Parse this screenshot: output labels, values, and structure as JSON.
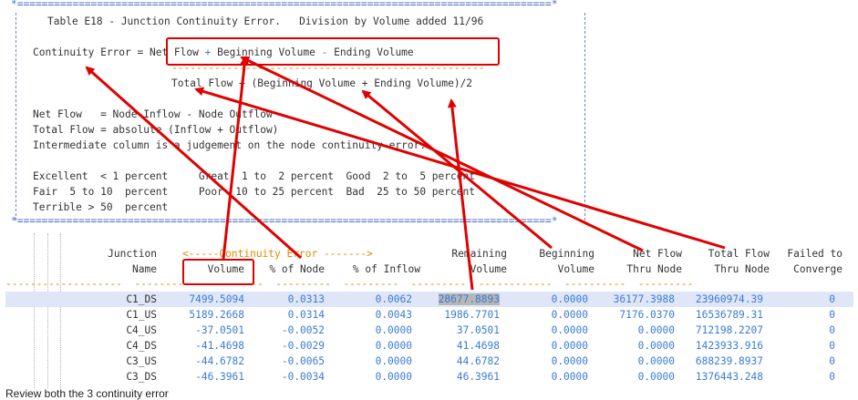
{
  "report": {
    "border_top": "*=======================================================================================*",
    "title": "Table E18 - Junction Continuity Error.   Division by Volume added 11/96",
    "formula": {
      "lhs": "Continuity Error = ",
      "net_flow": "Net Flow",
      "plus1": " + ",
      "beginning_volume": "Beginning Volume",
      "minus": " - ",
      "ending_volume": "Ending Volume",
      "divider": "---------------------------------------------------",
      "denominator": "Total Flow + (Beginning Volume + Ending Volume)/2"
    },
    "defs": [
      "Net Flow   = Node Inflow - Node Outflow",
      "Total Flow = absolute (Inflow + Outflow)",
      "Intermediate column is a judgement on the node continuity error."
    ],
    "ratings": {
      "line1": "Excellent  < 1 percent     Great  1 to  2 percent  Good  2 to  5 percent",
      "line2": "Fair  5 to 10  percent     Poor  10 to 25 percent  Bad  25 to 50 percent",
      "line3": "Terrible > 50  percent"
    },
    "border_bottom": "*=======================================================================================*"
  },
  "table": {
    "group_header": "<-----Continuity Error ------->",
    "headers": [
      {
        "line1": "Junction",
        "line2": "Name"
      },
      {
        "line1": "",
        "line2": "Volume"
      },
      {
        "line1": "",
        "line2": "% of Node"
      },
      {
        "line1": "",
        "line2": "% of Inflow"
      },
      {
        "line1": "Remaining",
        "line2": "Volume"
      },
      {
        "line1": "Beginning",
        "line2": "Volume"
      },
      {
        "line1": "Net Flow",
        "line2": "Thru Node"
      },
      {
        "line1": "Total Flow",
        "line2": "Thru Node"
      },
      {
        "line1": "Failed to",
        "line2": "Converge"
      }
    ],
    "underline": "-------------------  ----------  ---------  ---------  ---------  ---------  ------------  ----------  ---------",
    "rows": [
      [
        "C1_DS",
        "7499.5094",
        "0.0313",
        "0.0062",
        "28677.8893",
        "0.0000",
        "36177.3988",
        "23960974.39",
        "0"
      ],
      [
        "C1_US",
        "5189.2668",
        "0.0314",
        "0.0043",
        "1986.7701",
        "0.0000",
        "7176.0370",
        "16536789.31",
        "0"
      ],
      [
        "C4_US",
        "-37.0501",
        "-0.0052",
        "0.0000",
        "37.0501",
        "0.0000",
        "0.0000",
        "712198.2207",
        "0"
      ],
      [
        "C4_DS",
        "-41.4698",
        "-0.0029",
        "0.0000",
        "41.4698",
        "0.0000",
        "0.0000",
        "1423933.916",
        "0"
      ],
      [
        "C3_US",
        "-44.6782",
        "-0.0065",
        "0.0000",
        "44.6782",
        "0.0000",
        "0.0000",
        "688239.8937",
        "0"
      ],
      [
        "C3_DS",
        "-46.3961",
        "-0.0034",
        "0.0000",
        "46.3961",
        "0.0000",
        "0.0000",
        "1376443.248",
        "0"
      ]
    ]
  },
  "caption": "Review both the 3 continuity error",
  "colors": {
    "red": "#e00000",
    "blue": "#3a7bd5",
    "orange": "#e08a00",
    "highlight_row": "#dfe6f8"
  }
}
